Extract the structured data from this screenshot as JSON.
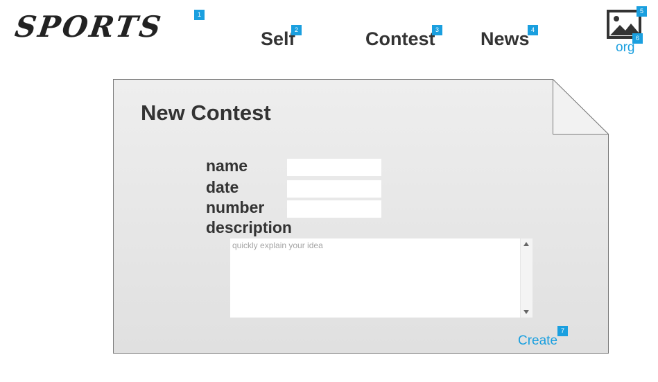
{
  "header": {
    "logo_text": "SPORTS",
    "nav": [
      {
        "label": "Self",
        "badge": "2"
      },
      {
        "label": "Contest",
        "badge": "3"
      },
      {
        "label": "News",
        "badge": "4"
      }
    ],
    "logo_badge": "1",
    "org_image_badge": "5",
    "org_link": {
      "label": "org",
      "badge": "6"
    }
  },
  "form": {
    "title": "New Contest",
    "fields": [
      {
        "label": "name",
        "value": ""
      },
      {
        "label": "date",
        "value": ""
      },
      {
        "label": "number",
        "value": ""
      }
    ],
    "description_label": "description",
    "description_placeholder": "quickly explain your idea",
    "description_value": "",
    "create_label": "Create",
    "create_badge": "7"
  },
  "colors": {
    "accent": "#1a9fdf",
    "text": "#333333",
    "panel_fill_top": "#eeeeee",
    "panel_fill_bottom": "#e0e0e0",
    "panel_border": "#7a7a7a"
  },
  "icons": {
    "org_image": "image-placeholder-icon",
    "scroll_up": "triangle-up-icon",
    "scroll_down": "triangle-down-icon"
  }
}
